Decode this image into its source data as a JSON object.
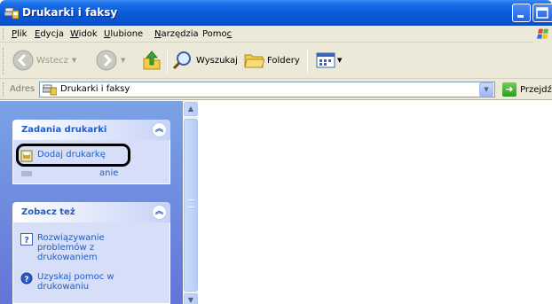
{
  "window": {
    "title": "Drukarki i faksy",
    "title_bar_color": "#0a5ad8"
  },
  "menubar": {
    "items": [
      {
        "label": "Plik",
        "accel": "P"
      },
      {
        "label": "Edycja",
        "accel": "E"
      },
      {
        "label": "Widok",
        "accel": "W"
      },
      {
        "label": "Ulubione",
        "accel": "U"
      },
      {
        "label": "Narzędzia",
        "accel": "N"
      },
      {
        "label": "Pomoc",
        "accel": "c"
      }
    ]
  },
  "toolbar": {
    "back_label": "Wstecz",
    "search_label": "Wyszukaj",
    "folders_label": "Foldery"
  },
  "addressbar": {
    "label": "Adres",
    "value": "Drukarki i faksy",
    "go_label": "Przejdź"
  },
  "taskpane": {
    "printer_tasks": {
      "title": "Zadania drukarki",
      "items": [
        {
          "label": "Dodaj drukarkę",
          "icon": "add-printer-icon"
        }
      ],
      "partial_text": "anie"
    },
    "see_also": {
      "title": "Zobacz też",
      "items": [
        {
          "label": "Rozwiązywanie problemów z drukowaniem",
          "icon": "help-icon"
        },
        {
          "label": "Uzyskaj pomoc w drukowaniu",
          "icon": "help-circle-icon"
        }
      ]
    }
  },
  "colors": {
    "taskpane_top": "#7ba2e7",
    "taskpane_bottom": "#6375d6",
    "link": "#215dc6",
    "chrome": "#ece9d8"
  }
}
